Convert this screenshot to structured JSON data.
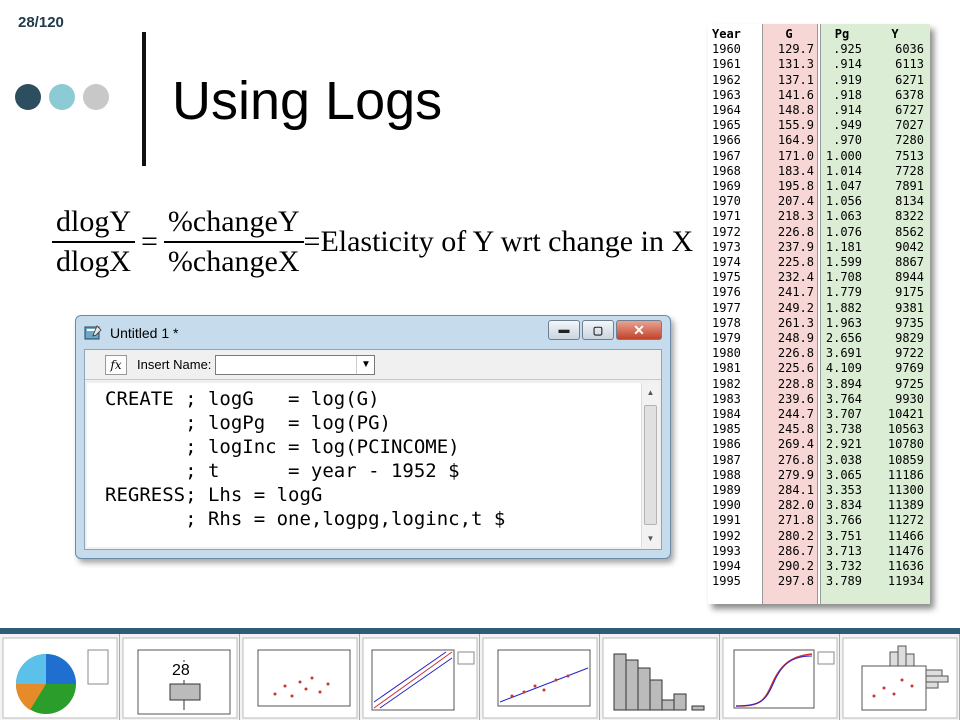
{
  "slide": {
    "number": "28/120",
    "title": "Using Logs",
    "dot_colors": [
      "#2c4e5e",
      "#8ccbd3",
      "#c8c8c8"
    ]
  },
  "formula": {
    "left_num": "dlogY",
    "left_den": "dlogX",
    "equals": "=",
    "right_num": "%changeY",
    "right_den": "%changeX",
    "tail": "=Elasticity of Y wrt change in X"
  },
  "table": {
    "headers": [
      "Year",
      "G",
      "Pg",
      "Y"
    ],
    "rows": [
      [
        "1960",
        "129.7",
        ".925",
        "6036"
      ],
      [
        "1961",
        "131.3",
        ".914",
        "6113"
      ],
      [
        "1962",
        "137.1",
        ".919",
        "6271"
      ],
      [
        "1963",
        "141.6",
        ".918",
        "6378"
      ],
      [
        "1964",
        "148.8",
        ".914",
        "6727"
      ],
      [
        "1965",
        "155.9",
        ".949",
        "7027"
      ],
      [
        "1966",
        "164.9",
        ".970",
        "7280"
      ],
      [
        "1967",
        "171.0",
        "1.000",
        "7513"
      ],
      [
        "1968",
        "183.4",
        "1.014",
        "7728"
      ],
      [
        "1969",
        "195.8",
        "1.047",
        "7891"
      ],
      [
        "1970",
        "207.4",
        "1.056",
        "8134"
      ],
      [
        "1971",
        "218.3",
        "1.063",
        "8322"
      ],
      [
        "1972",
        "226.8",
        "1.076",
        "8562"
      ],
      [
        "1973",
        "237.9",
        "1.181",
        "9042"
      ],
      [
        "1974",
        "225.8",
        "1.599",
        "8867"
      ],
      [
        "1975",
        "232.4",
        "1.708",
        "8944"
      ],
      [
        "1976",
        "241.7",
        "1.779",
        "9175"
      ],
      [
        "1977",
        "249.2",
        "1.882",
        "9381"
      ],
      [
        "1978",
        "261.3",
        "1.963",
        "9735"
      ],
      [
        "1979",
        "248.9",
        "2.656",
        "9829"
      ],
      [
        "1980",
        "226.8",
        "3.691",
        "9722"
      ],
      [
        "1981",
        "225.6",
        "4.109",
        "9769"
      ],
      [
        "1982",
        "228.8",
        "3.894",
        "9725"
      ],
      [
        "1983",
        "239.6",
        "3.764",
        "9930"
      ],
      [
        "1984",
        "244.7",
        "3.707",
        "10421"
      ],
      [
        "1985",
        "245.8",
        "3.738",
        "10563"
      ],
      [
        "1986",
        "269.4",
        "2.921",
        "10780"
      ],
      [
        "1987",
        "276.8",
        "3.038",
        "10859"
      ],
      [
        "1988",
        "279.9",
        "3.065",
        "11186"
      ],
      [
        "1989",
        "284.1",
        "3.353",
        "11300"
      ],
      [
        "1990",
        "282.0",
        "3.834",
        "11389"
      ],
      [
        "1991",
        "271.8",
        "3.766",
        "11272"
      ],
      [
        "1992",
        "280.2",
        "3.751",
        "11466"
      ],
      [
        "1993",
        "286.7",
        "3.713",
        "11476"
      ],
      [
        "1994",
        "290.2",
        "3.732",
        "11636"
      ],
      [
        "1995",
        "297.8",
        "3.789",
        "11934"
      ]
    ]
  },
  "window": {
    "title": "Untitled 1 *",
    "fx_label": "fx",
    "insert_label": "Insert Name:",
    "insert_value": "",
    "code_lines": [
      "CREATE ; logG   = log(G)",
      "       ; logPg  = log(PG)",
      "       ; logInc = log(PCINCOME)",
      "       ; t      = year - 1952 $",
      "REGRESS; Lhs = logG",
      "       ; Rhs = one,logpg,loginc,t $"
    ],
    "minimize_glyph": "▬",
    "maximize_glyph": "▢",
    "close_glyph": "✕"
  },
  "strip": {
    "page_number": "28"
  }
}
